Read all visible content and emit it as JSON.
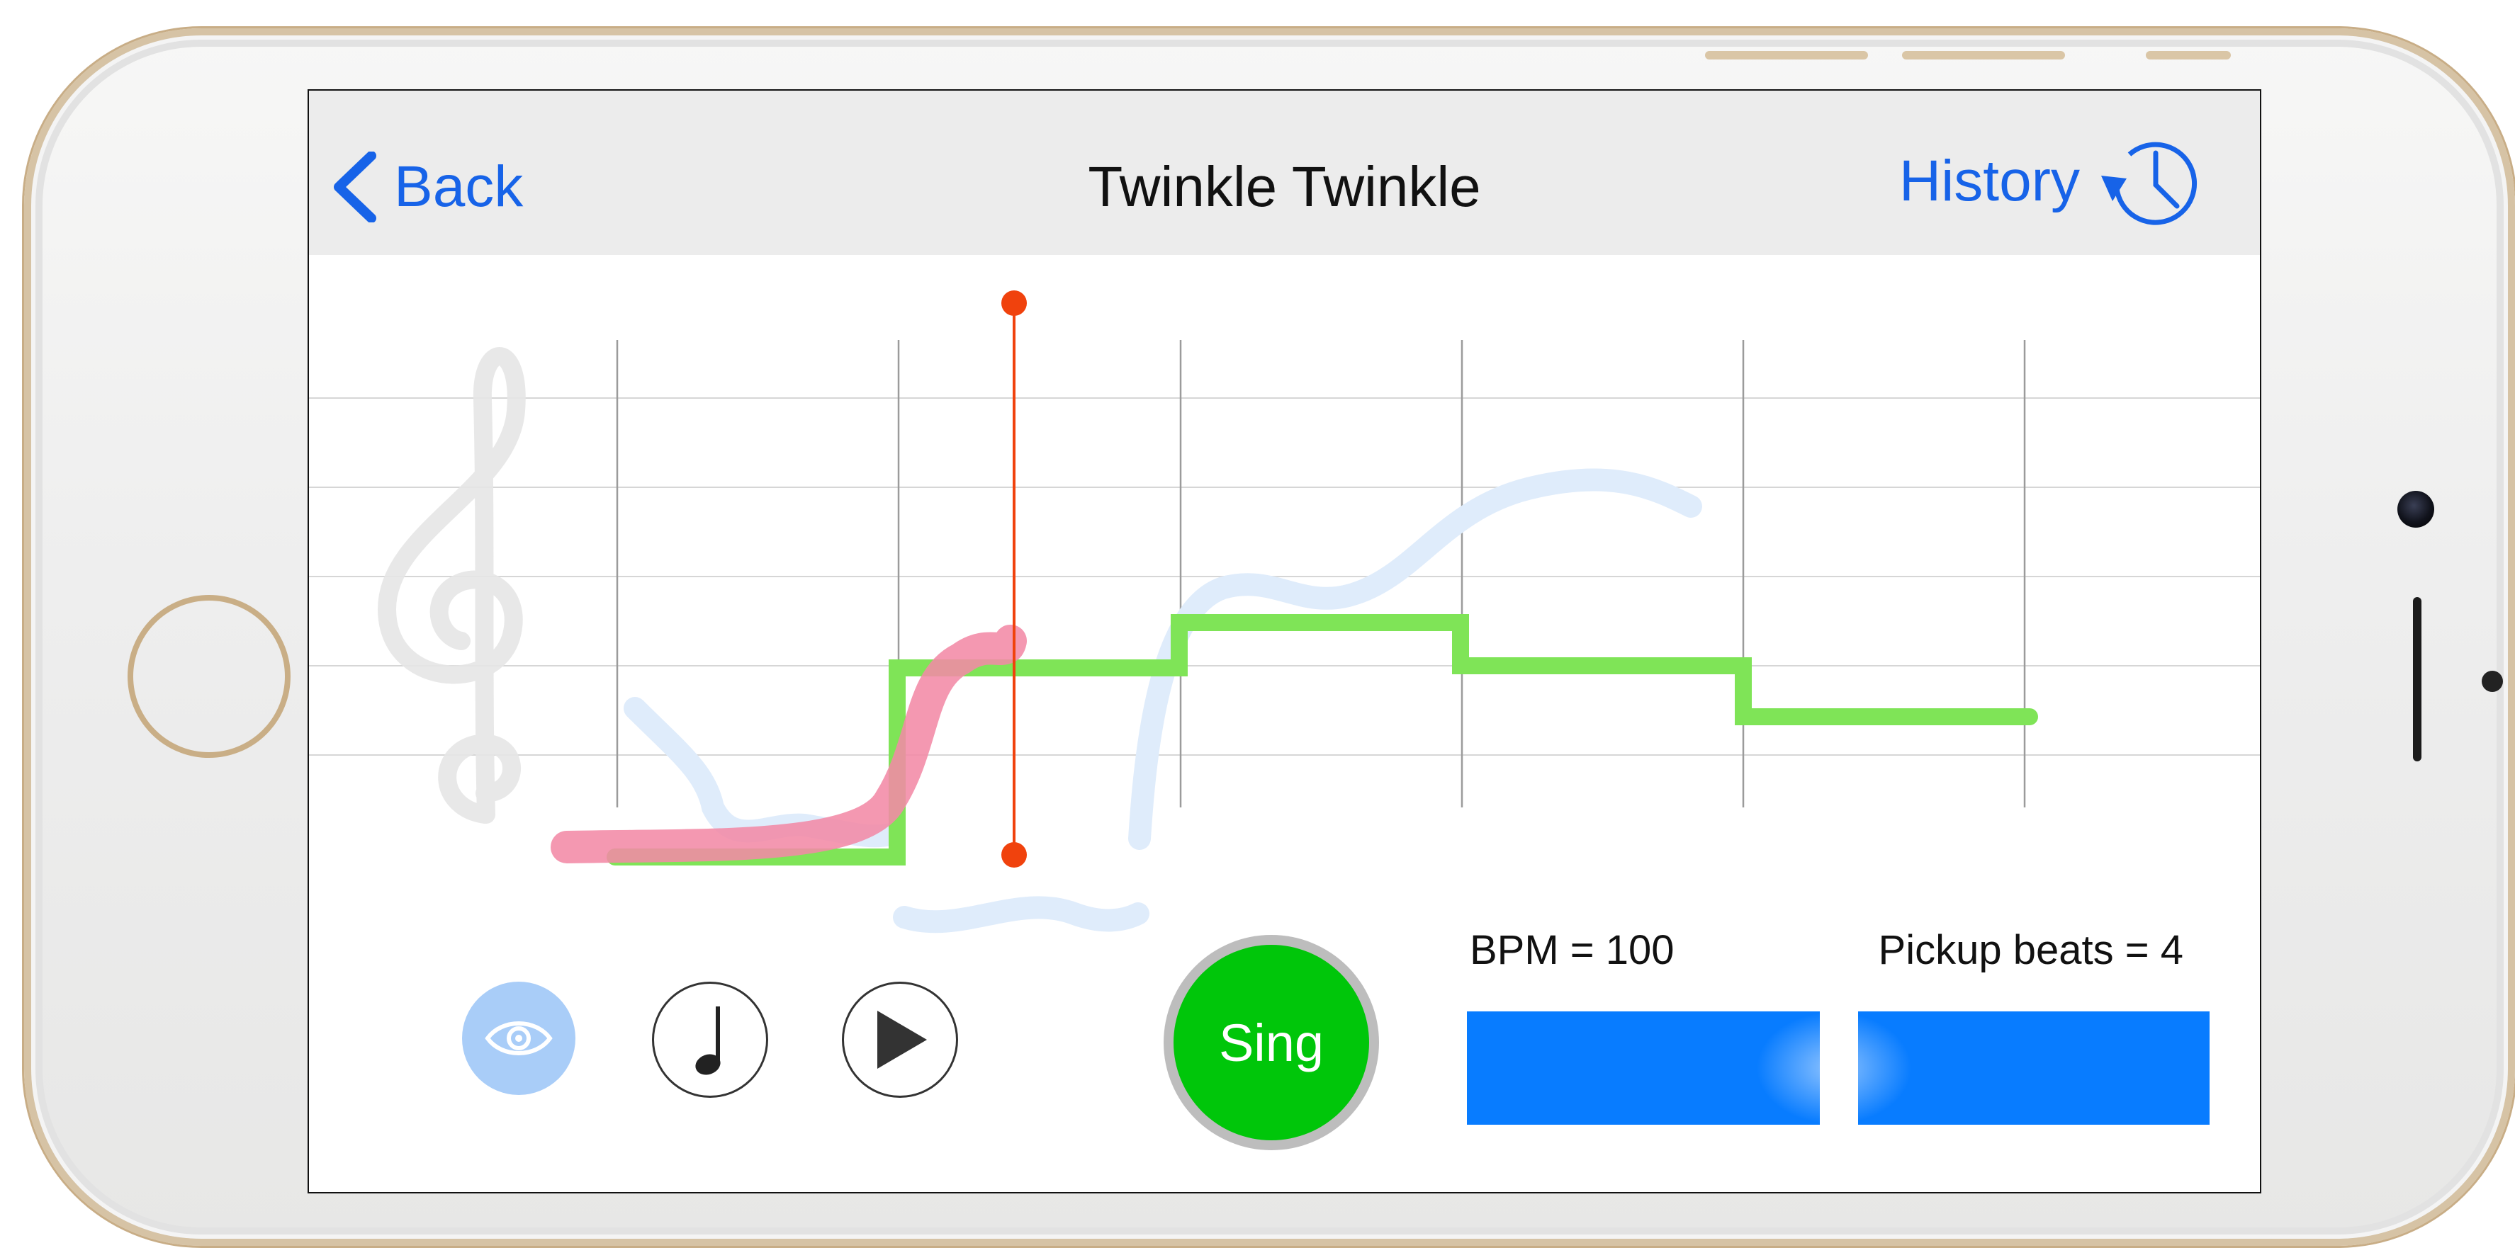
{
  "nav": {
    "back_label": "Back",
    "title": "Twinkle Twinkle",
    "history_label": "History"
  },
  "controls": {
    "sing_label": "Sing",
    "bpm_text": "BPM = 100",
    "pickup_text": "Pickup beats = 4",
    "tempo_slider_position": 0.5
  },
  "colors": {
    "accent": "#1763e8",
    "sing_button": "#00c60a",
    "slider": "#087cff",
    "target_line": "#7fe457",
    "sung_line": "#f28aa6",
    "playhead": "#f0420d"
  },
  "icons": {
    "back": "chevron-left-icon",
    "history": "history-clock-icon",
    "clef": "treble-clef-icon",
    "eye": "eye-icon",
    "note": "quarter-note-icon",
    "play": "play-icon"
  }
}
